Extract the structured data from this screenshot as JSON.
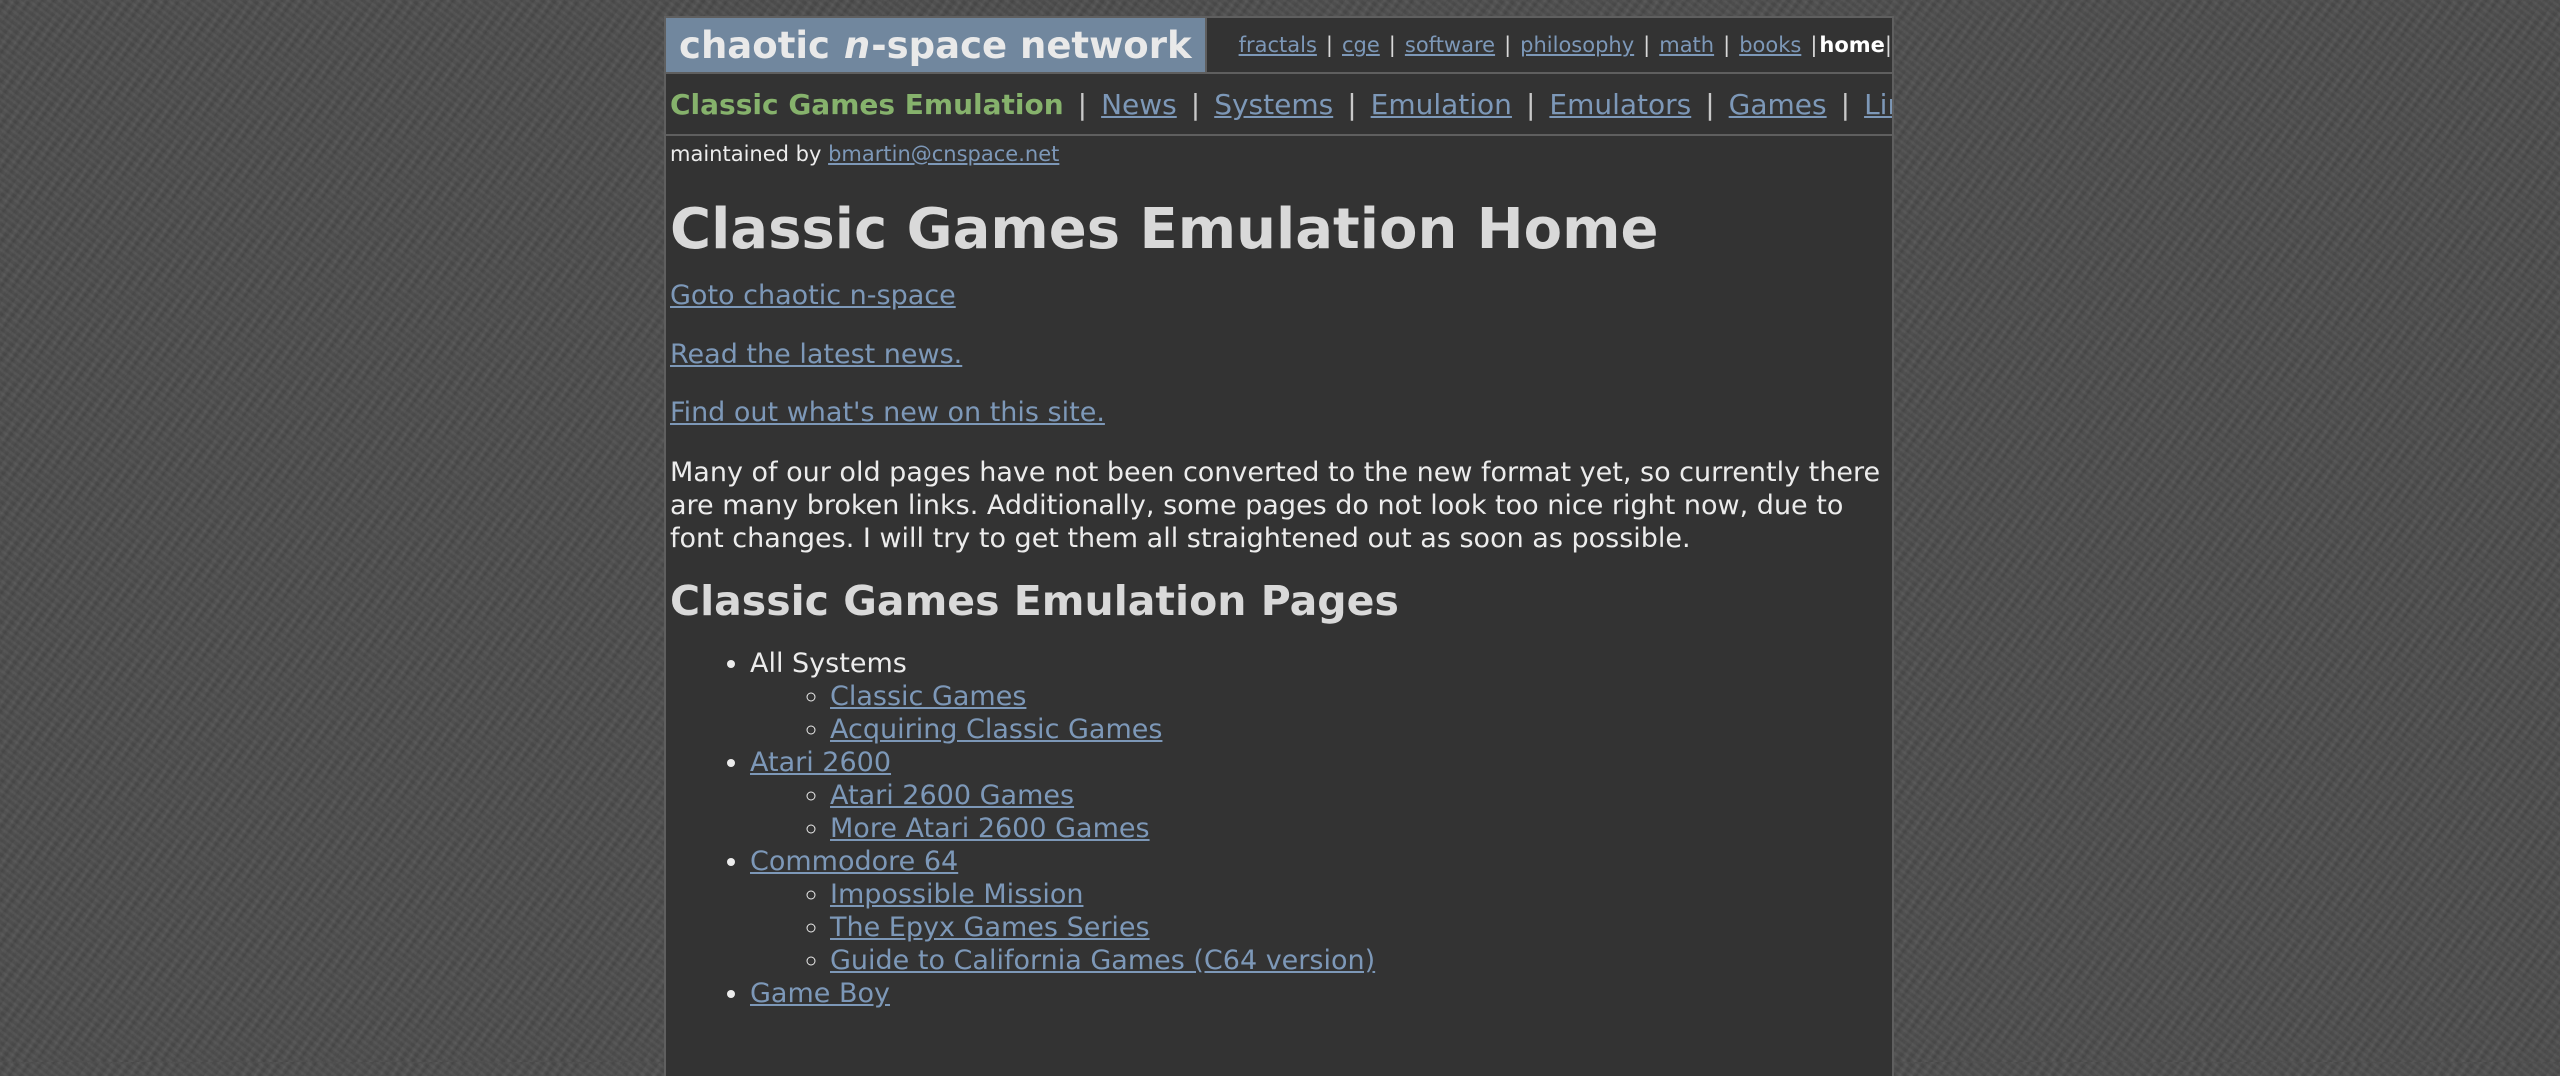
{
  "site": {
    "brand_pre": "chaotic ",
    "brand_n": "n",
    "brand_post": "-space network"
  },
  "top_nav": {
    "items": [
      "fractals",
      "cge",
      "software",
      "philosophy",
      "math",
      "books"
    ],
    "current": "home"
  },
  "section_nav": {
    "title": "Classic Games Emulation",
    "items": [
      "News",
      "Systems",
      "Emulation",
      "Emulators",
      "Games",
      "Links"
    ]
  },
  "maintained": {
    "label": "maintained by",
    "email": "bmartin@cnspace.net"
  },
  "page": {
    "heading": "Classic Games Emulation Home",
    "link_goto": "Goto chaotic n-space",
    "link_news": "Read the latest news.",
    "link_whatsnew": "Find out what's new on this site.",
    "notice": "Many of our old pages have not been converted to the new format yet, so currently there are many broken links. Additionally, some pages do not look too nice right now, due to font changes. I will try to get them all straightened out as soon as possible.",
    "pages_heading": "Classic Games Emulation Pages"
  },
  "pages_list": {
    "all_systems": {
      "label": "All Systems",
      "children": [
        "Classic Games",
        "Acquiring Classic Games"
      ]
    },
    "atari": {
      "label": "Atari 2600",
      "children": [
        "Atari 2600 Games",
        "More Atari 2600 Games"
      ]
    },
    "c64": {
      "label": "Commodore 64",
      "children": [
        "Impossible Mission",
        "The Epyx Games Series",
        "Guide to California Games (C64 version)"
      ]
    },
    "gameboy": {
      "label": "Game Boy"
    }
  },
  "colors": {
    "link": "#7d98b8",
    "brand_bg": "#71879e",
    "section_title": "#86b26c",
    "panel_bg": "#333333"
  }
}
